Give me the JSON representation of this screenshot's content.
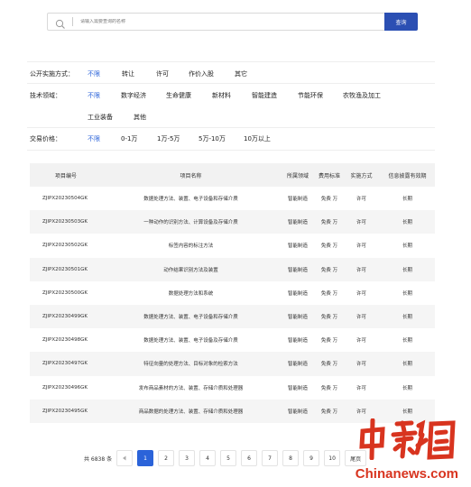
{
  "search": {
    "placeholder": "请输入需要查询的名称",
    "button_label": "查询"
  },
  "filters": [
    {
      "label": "公开实施方式：",
      "options": [
        "不限",
        "转让",
        "许可",
        "作价入股",
        "其它"
      ],
      "active": 0
    },
    {
      "label": "技术领域：",
      "options": [
        "不限",
        "数字经济",
        "生命健康",
        "新材料",
        "智能建造",
        "节能环保",
        "农牧渔及加工",
        "工业装备",
        "其他"
      ],
      "active": 0
    },
    {
      "label": "交易价格：",
      "options": [
        "不限",
        "0-1万",
        "1万-5万",
        "5万-10万",
        "10万以上"
      ],
      "active": 0
    }
  ],
  "table": {
    "headers": [
      "项目编号",
      "项目名称",
      "所属领域",
      "费用标准",
      "实施方式",
      "信息披露有效期"
    ],
    "rows": [
      [
        "ZJIPX20230504GK",
        "数据处理方法、装置、电子设备和存储介质",
        "智能制造",
        "免费 万",
        "许可",
        "长期"
      ],
      [
        "ZJIPX20230503GK",
        "一种动作的识别方法、计算设备及存储介质",
        "智能制造",
        "免费 万",
        "许可",
        "长期"
      ],
      [
        "ZJIPX20230502GK",
        "标签内容的标注方法",
        "智能制造",
        "免费 万",
        "许可",
        "长期"
      ],
      [
        "ZJIPX20230501GK",
        "动作结果识别方法及装置",
        "智能制造",
        "免费 万",
        "许可",
        "长期"
      ],
      [
        "ZJIPX20230500GK",
        "数据处理方法和系统",
        "智能制造",
        "免费 万",
        "许可",
        "长期"
      ],
      [
        "ZJIPX20230499GK",
        "数据处理方法、装置、电子设备和存储介质",
        "智能制造",
        "免费 万",
        "许可",
        "长期"
      ],
      [
        "ZJIPX20230498GK",
        "数据处理方法、装置、电子设备及存储介质",
        "智能制造",
        "免费 万",
        "许可",
        "长期"
      ],
      [
        "ZJIPX20230497GK",
        "特征向量的处理方法、目标对象的检索方法",
        "智能制造",
        "免费 万",
        "许可",
        "长期"
      ],
      [
        "ZJIPX20230496GK",
        "发布商品素材的方法、装置、存储介质和处理器",
        "智能制造",
        "免费 万",
        "许可",
        "长期"
      ],
      [
        "ZJIPX20230495GK",
        "商品数据的处理方法、装置、存储介质和处理器",
        "智能制造",
        "免费 万",
        "许可",
        "长期"
      ]
    ]
  },
  "pagination": {
    "total": "共 6838 条",
    "pages": [
      "1",
      "2",
      "3",
      "4",
      "5",
      "6",
      "7",
      "8",
      "9",
      "10"
    ],
    "current": "1",
    "last_label": "尾页"
  },
  "watermark": {
    "chinese": "中新网",
    "english": "Chinanews.com"
  },
  "colors": {
    "accent": "#2b63d9",
    "search_button": "#2b4fb3",
    "watermark": "#d8341f"
  }
}
